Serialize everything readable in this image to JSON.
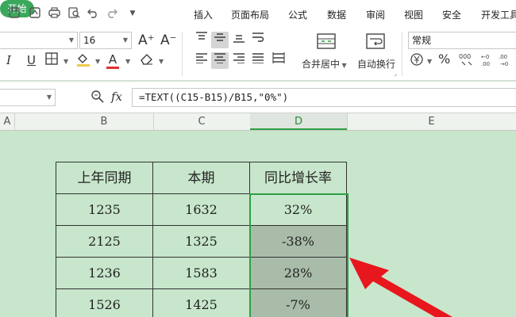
{
  "menu": {
    "tabs": [
      "开始",
      "插入",
      "页面布局",
      "公式",
      "数据",
      "审阅",
      "视图",
      "安全",
      "开发工具"
    ]
  },
  "ribbon": {
    "font_name": "",
    "font_size": "16",
    "number_format": "常规",
    "merge_label": "合并居中",
    "wrap_label": "自动换行",
    "percent_symbol": "%",
    "increase_font": "A⁺",
    "decrease_font": "A⁻",
    "italic": "I",
    "underline": "U",
    "font_color_letter": "A"
  },
  "formula_bar": {
    "name_box": "",
    "fx_label": "fx",
    "formula": "=TEXT((C15-B15)/B15,\"0%\")"
  },
  "columns": [
    "A",
    "B",
    "C",
    "D",
    "E"
  ],
  "table": {
    "headers": [
      "上年同期",
      "本期",
      "同比增长率"
    ],
    "rows": [
      [
        "1235",
        "1632",
        "32%"
      ],
      [
        "2125",
        "1325",
        "-38%"
      ],
      [
        "1236",
        "1583",
        "28%"
      ],
      [
        "1526",
        "1425",
        "-7%"
      ]
    ]
  },
  "colors": {
    "accent": "#3aa85c",
    "sheet_background": "#c7e6cb",
    "selection_border": "#2f9e44",
    "arrow": "#e8161d"
  }
}
